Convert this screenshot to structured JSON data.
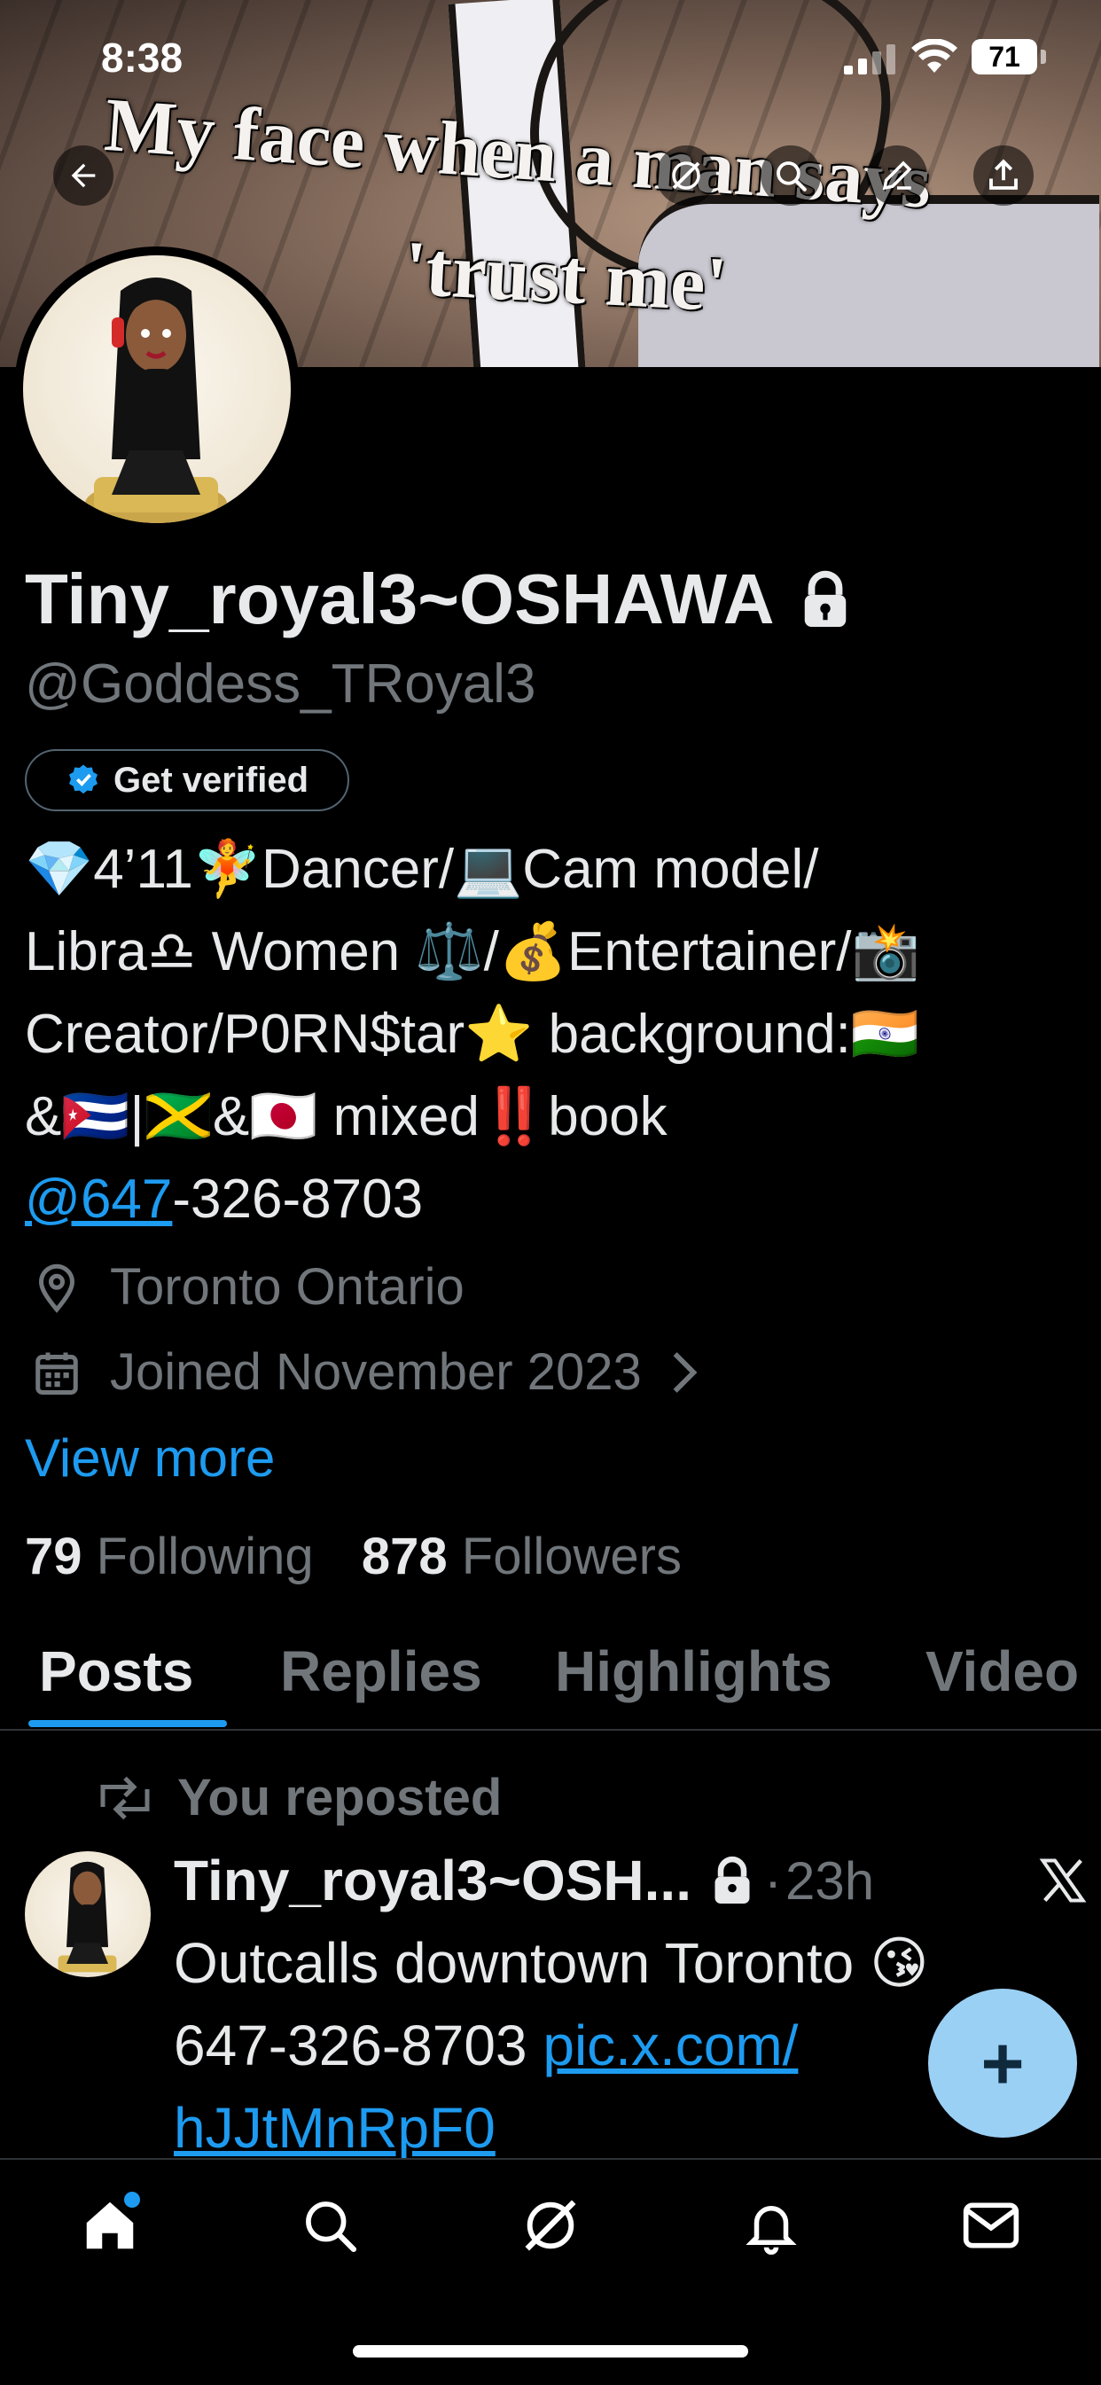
{
  "status_bar": {
    "time": "8:38",
    "battery": "71"
  },
  "banner": {
    "caption_line1": "My face when a man says",
    "caption_line2": "'trust me'"
  },
  "profile": {
    "display_name": "Tiny_royal3~OSHAWA",
    "handle": "@Goddess_TRoyal3",
    "verify_button": "Get verified",
    "bio_lines": [
      "💎4’11🧚Dancer/💻Cam model/",
      "Libra♎ Women ⚖️/💰Entertainer/📸",
      "Creator/P0RN$tar⭐ background:🇮🇳",
      "&🇨🇺|🇯🇲&🇯🇵 mixed‼️book"
    ],
    "bio_mention": "@647",
    "bio_phone_rest": "-326-8703",
    "location": "Toronto Ontario",
    "joined": "Joined November 2023",
    "view_more": "View more",
    "following_count": "79",
    "following_label": "Following",
    "followers_count": "878",
    "followers_label": "Followers"
  },
  "tabs": [
    "Posts",
    "Replies",
    "Highlights",
    "Video"
  ],
  "active_tab": "Posts",
  "post": {
    "repost_label": "You reposted",
    "author": "Tiny_royal3~OSH...",
    "dot": "·",
    "time": "23h",
    "text_line1": "Outcalls downtown Toronto 😘",
    "text_phone": "647-326-8703 ",
    "link_part1": "pic.x.com/",
    "link_part2": "hJJtMnRpF0"
  },
  "fab": {
    "label": "+"
  },
  "colors": {
    "accent": "#1d9bf0",
    "muted": "#71767b",
    "text": "#e7e9ea",
    "background": "#000000",
    "fab": "#9bd0f5"
  },
  "icons": [
    "back-arrow-icon",
    "grok-icon",
    "search-icon",
    "edit-icon",
    "share-icon",
    "lock-icon",
    "verified-badge-icon",
    "location-pin-icon",
    "calendar-icon",
    "chevron-right-icon",
    "repost-icon",
    "x-logo-icon",
    "home-icon",
    "bell-icon",
    "mail-icon"
  ]
}
